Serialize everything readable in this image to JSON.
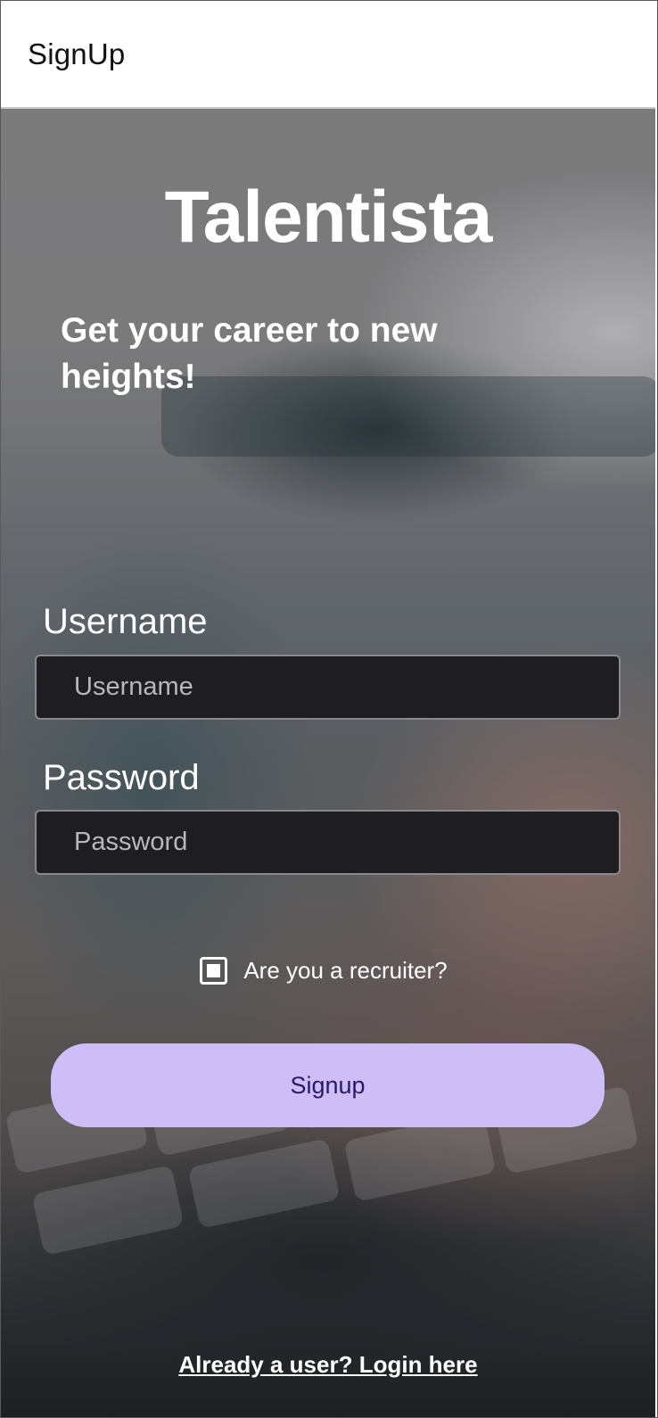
{
  "app_bar": {
    "title": "SignUp"
  },
  "hero": {
    "brand": "Talentista",
    "tagline": "Get your career to new heights!"
  },
  "form": {
    "username": {
      "label": "Username",
      "placeholder": "Username",
      "value": ""
    },
    "password": {
      "label": "Password",
      "placeholder": "Password",
      "value": ""
    },
    "recruiter_checkbox": {
      "label": "Are you a recruiter?",
      "checked": true
    },
    "submit_label": "Signup"
  },
  "footer": {
    "login_link": "Already a user? Login here"
  },
  "colors": {
    "button_bg": "#cdbef7",
    "button_text": "#2a1a66",
    "input_bg": "#1e1d22",
    "app_bar_bg": "#ffffff"
  }
}
